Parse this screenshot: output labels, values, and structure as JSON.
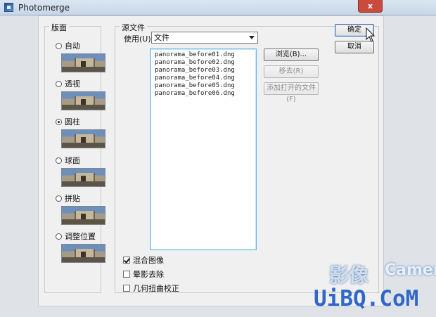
{
  "window": {
    "title": "Photomerge",
    "close_label": "x"
  },
  "layout": {
    "title": "版面",
    "options": [
      {
        "label": "自动",
        "selected": false
      },
      {
        "label": "透视",
        "selected": false
      },
      {
        "label": "圆柱",
        "selected": true
      },
      {
        "label": "球面",
        "selected": false
      },
      {
        "label": "拼贴",
        "selected": false
      },
      {
        "label": "调整位置",
        "selected": false
      }
    ]
  },
  "source": {
    "title": "源文件",
    "use_label": "使用(U):",
    "use_value": "文件",
    "files": [
      "panorama_before01.dng",
      "panorama_before02.dng",
      "panorama_before03.dng",
      "panorama_before04.dng",
      "panorama_before05.dng",
      "panorama_before06.dng"
    ],
    "buttons": {
      "browse": "浏览(B)...",
      "remove": "移去(R)",
      "add_open": "添加打开的文件(F)"
    }
  },
  "options": [
    {
      "label": "混合图像",
      "checked": true
    },
    {
      "label": "晕影去除",
      "checked": false
    },
    {
      "label": "几何扭曲校正",
      "checked": false
    }
  ],
  "dialog_buttons": {
    "ok": "确定",
    "cancel": "取消"
  },
  "watermark": {
    "top_left": "影像",
    "top_right": "Camera",
    "bottom": "UiBQ.CoM"
  }
}
